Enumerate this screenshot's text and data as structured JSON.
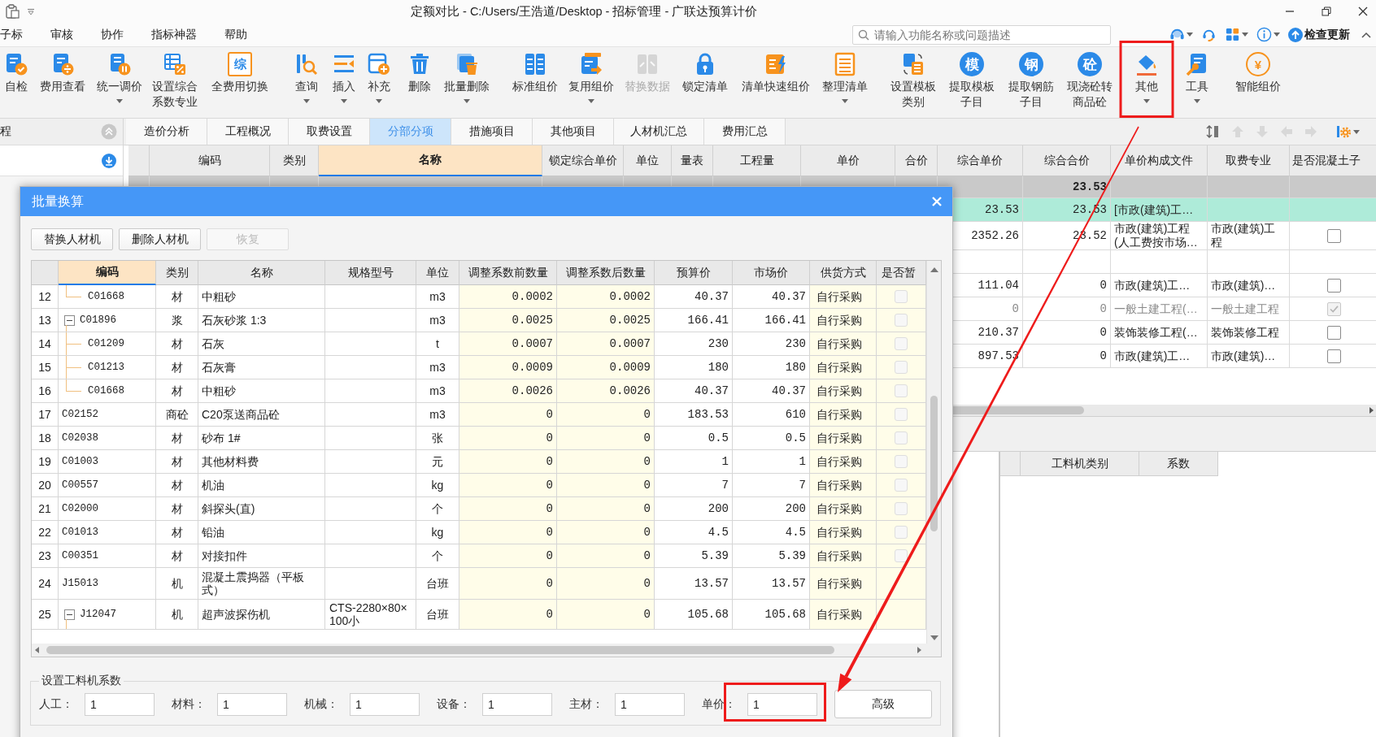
{
  "window": {
    "title": "定额对比 - C:/Users/王浩道/Desktop - 招标管理 - 广联达预算计价"
  },
  "menu": [
    {
      "label": "子标"
    },
    {
      "label": "审核"
    },
    {
      "label": "协作"
    },
    {
      "label": "指标神器"
    },
    {
      "label": "帮助"
    }
  ],
  "search": {
    "placeholder": "请输入功能名称或问题描述"
  },
  "header_tools": [
    {
      "dropdown": true
    },
    {
      "dropdown": false
    },
    {
      "dropdown": true
    },
    {
      "dropdown": true
    }
  ],
  "update_button": {
    "label": "检查更新"
  },
  "ribbon": [
    {
      "lines": [
        "自检"
      ],
      "dropdown": false,
      "disabled": false,
      "highlighted": false
    },
    {
      "lines": [
        "费用查看"
      ],
      "dropdown": false,
      "disabled": false,
      "highlighted": false
    },
    {
      "lines": [
        "统一调价"
      ],
      "dropdown": true,
      "disabled": false,
      "highlighted": false
    },
    {
      "lines": [
        "设置综合",
        "系数专业"
      ],
      "dropdown": false,
      "disabled": false,
      "highlighted": false
    },
    {
      "lines": [
        "全费用切换"
      ],
      "glyph": "综",
      "dropdown": false,
      "disabled": false,
      "highlighted": false
    },
    {
      "lines": [
        "查询"
      ],
      "dropdown": true,
      "disabled": false,
      "highlighted": false
    },
    {
      "lines": [
        "插入"
      ],
      "dropdown": true,
      "disabled": false,
      "highlighted": false
    },
    {
      "lines": [
        "补充"
      ],
      "dropdown": true,
      "disabled": false,
      "highlighted": false
    },
    {
      "lines": [
        "删除"
      ],
      "dropdown": false,
      "disabled": false,
      "highlighted": false
    },
    {
      "lines": [
        "批量删除"
      ],
      "dropdown": true,
      "disabled": false,
      "highlighted": false
    },
    {
      "lines": [
        "标准组价"
      ],
      "dropdown": false,
      "disabled": false,
      "highlighted": false
    },
    {
      "lines": [
        "复用组价"
      ],
      "dropdown": true,
      "disabled": false,
      "highlighted": false
    },
    {
      "lines": [
        "替换数据"
      ],
      "dropdown": false,
      "disabled": true,
      "highlighted": false
    },
    {
      "lines": [
        "锁定清单"
      ],
      "dropdown": false,
      "disabled": false,
      "highlighted": false
    },
    {
      "lines": [
        "清单快速组价"
      ],
      "dropdown": false,
      "disabled": false,
      "highlighted": false
    },
    {
      "lines": [
        "整理清单"
      ],
      "dropdown": true,
      "disabled": false,
      "highlighted": false
    },
    {
      "lines": [
        "设置模板",
        "类别"
      ],
      "dropdown": false,
      "disabled": false,
      "highlighted": false
    },
    {
      "lines": [
        "提取模板",
        "子目"
      ],
      "glyph": "模",
      "dropdown": false,
      "disabled": false,
      "highlighted": false
    },
    {
      "lines": [
        "提取钢筋",
        "子目"
      ],
      "glyph": "钢",
      "dropdown": false,
      "disabled": false,
      "highlighted": false
    },
    {
      "lines": [
        "现浇砼转",
        "商品砼"
      ],
      "glyph": "砼",
      "dropdown": false,
      "disabled": false,
      "highlighted": false
    },
    {
      "lines": [
        "其他"
      ],
      "dropdown": true,
      "disabled": false,
      "highlighted": true
    },
    {
      "lines": [
        "工具"
      ],
      "dropdown": true,
      "disabled": false,
      "highlighted": false
    },
    {
      "lines": [
        "智能组价"
      ],
      "glyph": "¥",
      "dropdown": false,
      "disabled": false,
      "highlighted": false
    }
  ],
  "sidebar": {
    "title": "程"
  },
  "tabs": [
    {
      "label": "造价分析",
      "selected": false
    },
    {
      "label": "工程概况",
      "selected": false
    },
    {
      "label": "取费设置",
      "selected": false
    },
    {
      "label": "分部分项",
      "selected": true
    },
    {
      "label": "措施项目",
      "selected": false
    },
    {
      "label": "其他项目",
      "selected": false
    },
    {
      "label": "人材机汇总",
      "selected": false
    },
    {
      "label": "费用汇总",
      "selected": false
    }
  ],
  "grid_tools": [
    {
      "disabled": false
    },
    {
      "disabled": true
    },
    {
      "disabled": true
    },
    {
      "disabled": true
    },
    {
      "disabled": true
    },
    {
      "disabled": false
    }
  ],
  "grid": {
    "columns": [
      {
        "label": "编码",
        "selected": false
      },
      {
        "label": "类别",
        "selected": false
      },
      {
        "label": "名称",
        "selected": true
      },
      {
        "label": "锁定综合单价",
        "selected": false
      },
      {
        "label": "单位",
        "selected": false
      },
      {
        "label": "量表",
        "selected": false
      },
      {
        "label": "工程量",
        "selected": false
      },
      {
        "label": "单价",
        "selected": false
      },
      {
        "label": "合价",
        "selected": false
      },
      {
        "label": "综合单价",
        "selected": false
      },
      {
        "label": "综合合价",
        "selected": false
      },
      {
        "label": "单价构成文件",
        "selected": false
      },
      {
        "label": "取费专业",
        "selected": false
      },
      {
        "label": "是否混凝土子",
        "selected": false
      }
    ],
    "rows": [
      {
        "kind": "group",
        "selected": false,
        "disabled": false,
        "composite_total": "23.53"
      },
      {
        "kind": "item",
        "selected": true,
        "disabled": false,
        "composite_price": "23.53",
        "composite_total": "23.53",
        "price_file": "[市政(建筑)工…"
      },
      {
        "kind": "item",
        "selected": false,
        "disabled": false,
        "composite_price": "2352.26",
        "composite_total": "23.52",
        "price_file": "市政(建筑)工程(人工费按市场…",
        "fee_specialty": "市政(建筑)工程",
        "checked": false
      },
      {
        "kind": "item",
        "selected": false
      },
      {
        "kind": "item",
        "selected": false,
        "disabled": false,
        "composite_price": "111.04",
        "composite_total": "0",
        "price_file": "市政(建筑)工…",
        "fee_specialty": "市政(建筑)…",
        "checked": false
      },
      {
        "kind": "item",
        "selected": false,
        "disabled": true,
        "composite_price": "0",
        "composite_total": "0",
        "price_file": "一般土建工程(…",
        "fee_specialty": "一般土建工程",
        "checked": true
      },
      {
        "kind": "item",
        "selected": false,
        "disabled": false,
        "composite_price": "210.37",
        "composite_total": "0",
        "price_file": "装饰装修工程(…",
        "fee_specialty": "装饰装修工程",
        "checked": false
      },
      {
        "kind": "item",
        "selected": false,
        "disabled": false,
        "composite_price": "897.53",
        "composite_total": "0",
        "price_file": "市政(建筑)工…",
        "fee_specialty": "市政(建筑)…",
        "checked": false
      }
    ]
  },
  "lower_pane": {
    "columns": [
      {
        "label": "工料机类别"
      },
      {
        "label": "系数"
      }
    ]
  },
  "dialog": {
    "title": "批量换算",
    "buttons": [
      {
        "label": "替换人材机",
        "disabled": false
      },
      {
        "label": "删除人材机",
        "disabled": false
      },
      {
        "label": "恢复",
        "disabled": true
      }
    ],
    "table": {
      "columns": [
        {
          "label": "编码",
          "selected": true,
          "editable": false
        },
        {
          "label": "类别",
          "selected": false,
          "editable": false
        },
        {
          "label": "名称",
          "selected": false,
          "editable": false
        },
        {
          "label": "规格型号",
          "selected": false,
          "editable": false
        },
        {
          "label": "单位",
          "selected": false,
          "editable": false
        },
        {
          "label": "调整系数前数量",
          "selected": false,
          "editable": true
        },
        {
          "label": "调整系数后数量",
          "selected": false,
          "editable": true
        },
        {
          "label": "预算价",
          "selected": false,
          "editable": false
        },
        {
          "label": "市场价",
          "selected": false,
          "editable": false
        },
        {
          "label": "供货方式",
          "selected": false,
          "editable": true
        },
        {
          "label": "是否暂",
          "selected": false,
          "editable": true
        }
      ],
      "rows": [
        {
          "children": [
            {
              "no": "12",
              "code": "C01668",
              "type": "材",
              "name": "中粗砂",
              "unit": "m3",
              "qty_before": "0.0002",
              "qty_after": "0.0002",
              "budget_price": "40.37",
              "market_price": "40.37",
              "supply": "自行采购",
              "provisional": false
            }
          ]
        },
        {
          "no": "13",
          "code": "C01896",
          "type": "浆",
          "name": "石灰砂浆 1:3",
          "unit": "m3",
          "qty_before": "0.0025",
          "qty_after": "0.0025",
          "budget_price": "166.41",
          "market_price": "166.41",
          "supply": "自行采购",
          "provisional": false,
          "expanded": true,
          "children": [
            {
              "no": "14",
              "code": "C01209",
              "type": "材",
              "name": "石灰",
              "unit": "t",
              "qty_before": "0.0007",
              "qty_after": "0.0007",
              "budget_price": "230",
              "market_price": "230",
              "supply": "自行采购",
              "provisional": false
            },
            {
              "no": "15",
              "code": "C01213",
              "type": "材",
              "name": "石灰膏",
              "unit": "m3",
              "qty_before": "0.0009",
              "qty_after": "0.0009",
              "budget_price": "180",
              "market_price": "180",
              "supply": "自行采购",
              "provisional": false
            },
            {
              "no": "16",
              "code": "C01668",
              "type": "材",
              "name": "中粗砂",
              "unit": "m3",
              "qty_before": "0.0026",
              "qty_after": "0.0026",
              "budget_price": "40.37",
              "market_price": "40.37",
              "supply": "自行采购",
              "provisional": false
            }
          ]
        },
        {
          "no": "17",
          "code": "C02152",
          "type": "商砼",
          "name": "C20泵送商品砼",
          "unit": "m3",
          "qty_before": "0",
          "qty_after": "0",
          "budget_price": "183.53",
          "market_price": "610",
          "supply": "自行采购",
          "provisional": false
        },
        {
          "no": "18",
          "code": "C02038",
          "type": "材",
          "name": "砂布 1#",
          "unit": "张",
          "qty_before": "0",
          "qty_after": "0",
          "budget_price": "0.5",
          "market_price": "0.5",
          "supply": "自行采购",
          "provisional": false
        },
        {
          "no": "19",
          "code": "C01003",
          "type": "材",
          "name": "其他材料费",
          "unit": "元",
          "qty_before": "0",
          "qty_after": "0",
          "budget_price": "1",
          "market_price": "1",
          "supply": "自行采购",
          "provisional": false
        },
        {
          "no": "20",
          "code": "C00557",
          "type": "材",
          "name": "机油",
          "unit": "kg",
          "qty_before": "0",
          "qty_after": "0",
          "budget_price": "7",
          "market_price": "7",
          "supply": "自行采购",
          "provisional": false
        },
        {
          "no": "21",
          "code": "C02000",
          "type": "材",
          "name": "斜探头(直)",
          "unit": "个",
          "qty_before": "0",
          "qty_after": "0",
          "budget_price": "200",
          "market_price": "200",
          "supply": "自行采购",
          "provisional": false
        },
        {
          "no": "22",
          "code": "C01013",
          "type": "材",
          "name": "铅油",
          "unit": "kg",
          "qty_before": "0",
          "qty_after": "0",
          "budget_price": "4.5",
          "market_price": "4.5",
          "supply": "自行采购",
          "provisional": false
        },
        {
          "no": "23",
          "code": "C00351",
          "type": "材",
          "name": "对接扣件",
          "unit": "个",
          "qty_before": "0",
          "qty_after": "0",
          "budget_price": "5.39",
          "market_price": "5.39",
          "supply": "自行采购",
          "provisional": false
        },
        {
          "no": "24",
          "code": "J15013",
          "type": "机",
          "name": "混凝土震捣器（平板式）",
          "unit": "台班",
          "qty_before": "0",
          "qty_after": "0",
          "budget_price": "13.57",
          "market_price": "13.57",
          "supply": "自行采购"
        },
        {
          "no": "25",
          "code": "J12047",
          "type": "机",
          "name": "超声波探伤机",
          "spec": "CTS-2280×80×100小",
          "unit": "台班",
          "qty_before": "0",
          "qty_after": "0",
          "budget_price": "105.68",
          "market_price": "105.68",
          "supply": "自行采购",
          "expanded": true
        }
      ]
    },
    "coefficients": {
      "title": "设置工料机系数",
      "fields": [
        {
          "label": "人工：",
          "value": "1",
          "highlighted": false
        },
        {
          "label": "材料：",
          "value": "1",
          "highlighted": false
        },
        {
          "label": "机械：",
          "value": "1",
          "highlighted": false
        },
        {
          "label": "设备：",
          "value": "1",
          "highlighted": false
        },
        {
          "label": "主材：",
          "value": "1",
          "highlighted": false
        },
        {
          "label": "单价：",
          "value": "1",
          "highlighted": true
        }
      ],
      "advanced_button": {
        "label": "高级"
      }
    }
  },
  "annotation_arrow": true
}
